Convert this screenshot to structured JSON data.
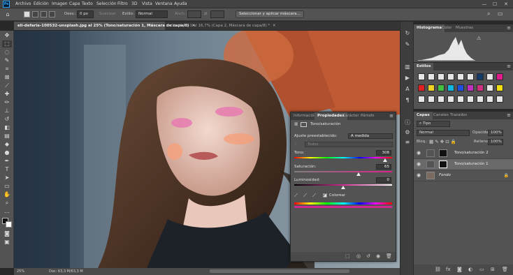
{
  "app": {
    "name": "Ps"
  },
  "menu": [
    "Archivo",
    "Edición",
    "Imagen",
    "Capa",
    "Texto",
    "Selección",
    "Filtro",
    "3D",
    "Vista",
    "Ventana",
    "Ayuda"
  ],
  "window_controls": {
    "minimize": "—",
    "maximize": "☐",
    "close": "✕"
  },
  "options_bar": {
    "desv_label": "Desv.:",
    "desv_value": "0 px",
    "suavizar_label": "Suavizar",
    "estilo_label": "Estilo:",
    "estilo_value": "Normal",
    "anch_label": "Anch.:",
    "select_mask_button": "Seleccionar y aplicar máscara..."
  },
  "document_tabs": [
    {
      "label": "eli-defaria-100532-unsplash.jpg al 25% (Tono/saturación 1, Máscara de capa/8)",
      "active": true,
      "close": "✕"
    },
    {
      "label": "Sin título-1 al 16,7% (Capa 2, Máscara de capa/8) *",
      "active": false,
      "close": "✕"
    }
  ],
  "status": {
    "zoom": "25%",
    "doc": "Doc: 63,3 M/63,3 M"
  },
  "panels": {
    "histogram_tabs": [
      "Histograma",
      "Color",
      "Muestras"
    ],
    "styles_tab": "Estilos",
    "layers_tabs": [
      "Capas",
      "Canales",
      "Trazados"
    ]
  },
  "styles": {
    "swatch_colors": [
      [
        "#e6e6e6",
        "#e6e6e6",
        "#e6e6e6",
        "#e6e6e6",
        "#e6e6e6",
        "#e6e6e6",
        "#123a6a",
        "#e6e6e6",
        "#e21a8c"
      ],
      [
        "#e02020",
        "#f0d020",
        "#40c040",
        "#10b8e0",
        "#2050e0",
        "#c030c0",
        "#d03080",
        "#e6e6e6",
        "#f0e010"
      ],
      [
        "#e6e6e6",
        "#e6e6e6",
        "#e6e6e6",
        "#e6e6e6",
        "#e6e6e6",
        "#e6e6e6",
        "#e6e6e6",
        "#e6e6e6",
        "#e6e6e6"
      ]
    ]
  },
  "layers": {
    "filter_value": "Tipo",
    "blend_mode": "Normal",
    "opacity_label": "Opacidad:",
    "opacity_value": "100%",
    "lock_label": "Bloq.:",
    "fill_label": "Relleno:",
    "fill_value": "100%",
    "items": [
      {
        "name": "Tono/saturación 2",
        "selected": false
      },
      {
        "name": "Tono/saturación 1",
        "selected": true
      },
      {
        "name": "Fondo",
        "selected": false
      }
    ]
  },
  "properties": {
    "tabs": [
      "Información",
      "Propiedades",
      "Carácter",
      "Párrafo"
    ],
    "title": "Tono/saturación",
    "preset_label": "Ajuste preestablecido:",
    "preset_value": "A medida",
    "channel_value": "Todos",
    "hue_label": "Tono:",
    "hue_value": "308",
    "saturation_label": "Saturación:",
    "saturation_value": "65",
    "lightness_label": "Luminosidad:",
    "lightness_value": "0",
    "colorize_label": "Colorear",
    "colorize_checked": true,
    "hue_slider_fraction": 0.93,
    "saturation_slider_fraction": 0.66,
    "lightness_slider_fraction": 0.5
  }
}
